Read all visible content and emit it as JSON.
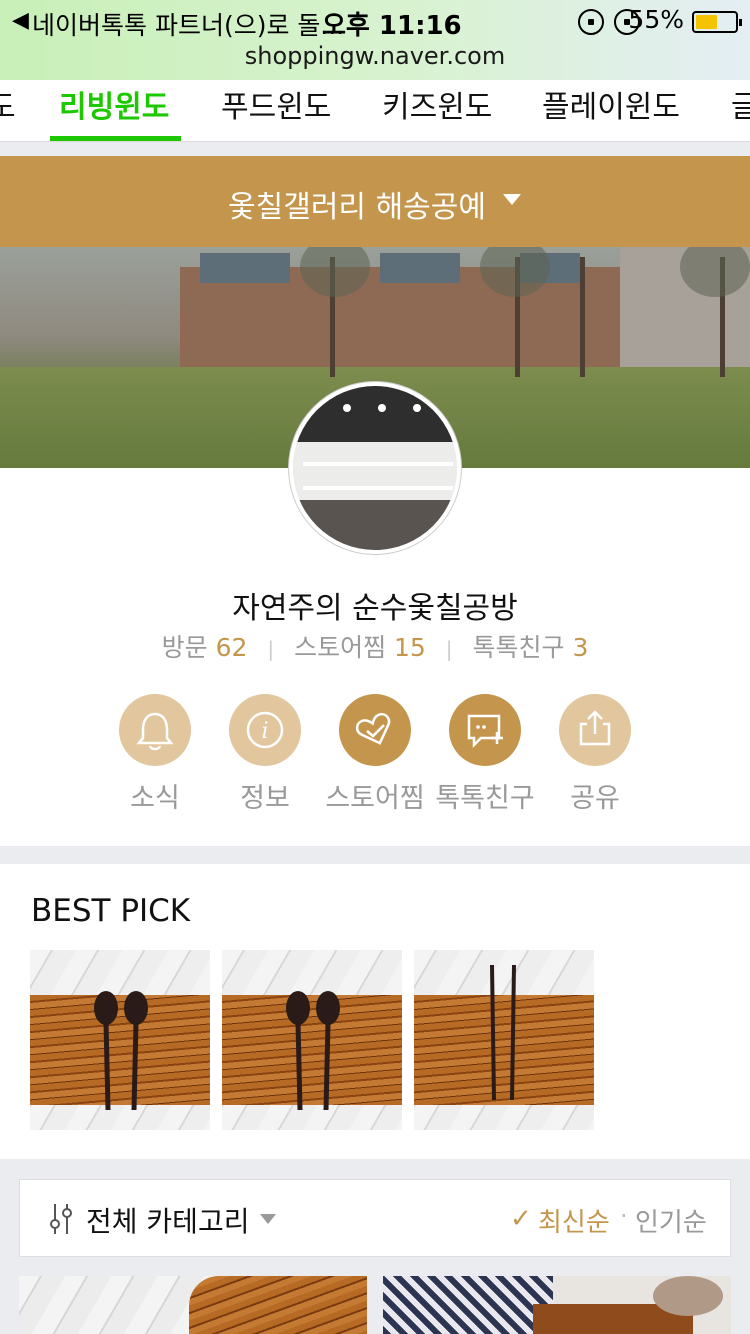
{
  "status_bar": {
    "back_app": "네이버톡톡 파트너(으)로 돌...",
    "time": "오후 11:16",
    "battery": "55%",
    "battery_level": 0.55,
    "url": "shoppingw.naver.com"
  },
  "tabs": [
    {
      "label": "도"
    },
    {
      "label": "리빙윈도",
      "active": true
    },
    {
      "label": "푸드윈도"
    },
    {
      "label": "키즈윈도"
    },
    {
      "label": "플레이윈도"
    },
    {
      "label": "글"
    }
  ],
  "selector": {
    "label": "옻칠갤러리 해송공예"
  },
  "store": {
    "name": "자연주의 순수옻칠공방",
    "stats": [
      {
        "label": "방문",
        "value": "62"
      },
      {
        "label": "스토어찜",
        "value": "15"
      },
      {
        "label": "톡톡친구",
        "value": "3"
      }
    ]
  },
  "actions": [
    {
      "label": "소식",
      "icon": "bell-icon"
    },
    {
      "label": "정보",
      "icon": "info-icon"
    },
    {
      "label": "스토어찜",
      "icon": "heart-check-icon"
    },
    {
      "label": "톡톡친구",
      "icon": "chat-plus-icon"
    },
    {
      "label": "공유",
      "icon": "share-icon"
    }
  ],
  "best_pick": {
    "title": "BEST PICK",
    "items": [
      {
        "type": "spoons"
      },
      {
        "type": "spoons"
      },
      {
        "type": "chopsticks"
      }
    ]
  },
  "category_bar": {
    "label": "전체 카테고리",
    "sort_selected": "최신순",
    "sort_other": "인기순",
    "separator": "·",
    "check": "✓"
  },
  "colors": {
    "accent_green": "#1ec800",
    "brand_gold": "#c4964d",
    "light_gold": "#e1c69e"
  }
}
